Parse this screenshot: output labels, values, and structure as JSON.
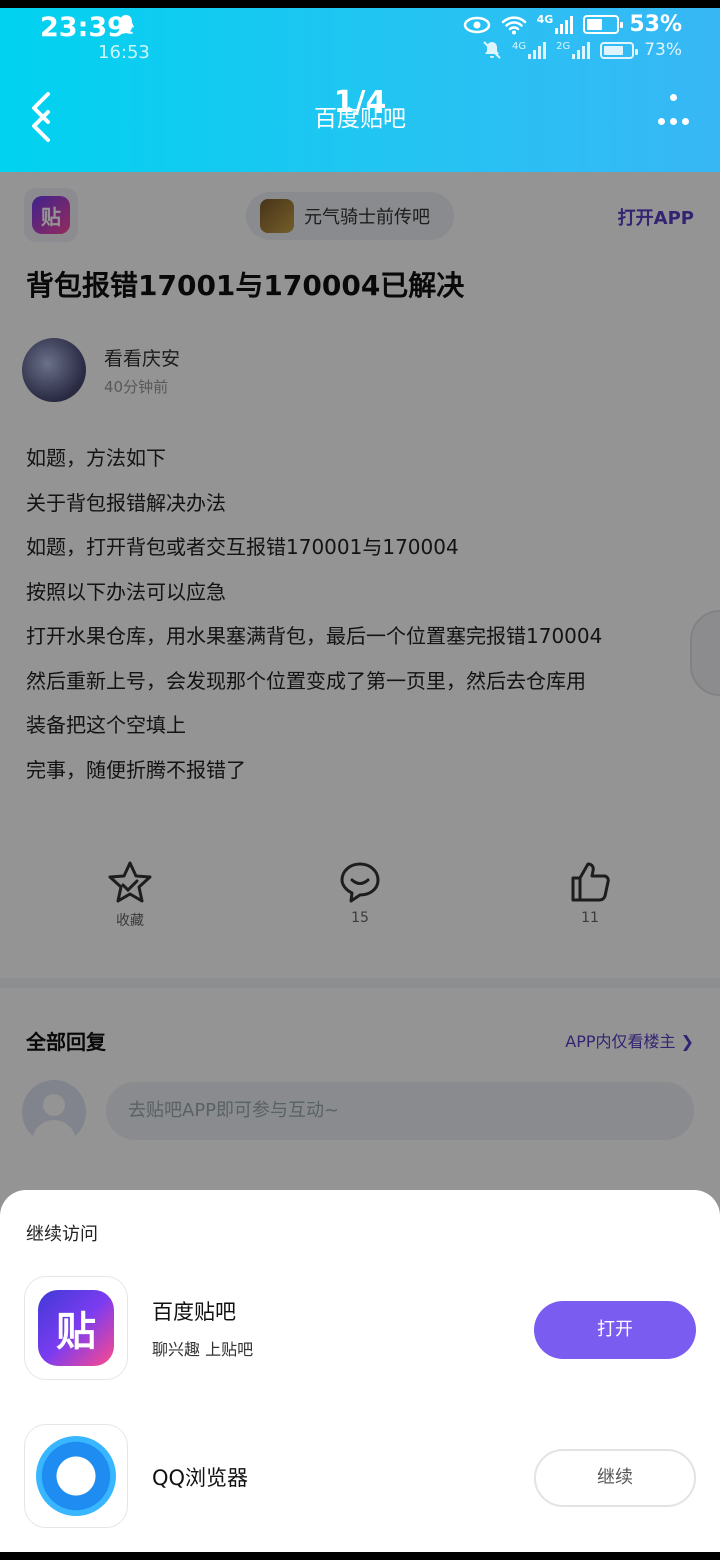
{
  "status_bar": {
    "time": "23:39",
    "time_secondary": "16:53",
    "network_primary": "4G",
    "battery_primary": "53%",
    "network_secondary_1": "4G",
    "network_secondary_2": "2G",
    "battery_secondary": "73%",
    "battery_primary_fraction": 0.53,
    "battery_secondary_fraction": 0.73
  },
  "header": {
    "page_counter": "1/4",
    "title": "百度贴吧",
    "back_icon": "chevron-left-icon",
    "more_icon": "more-dots-icon"
  },
  "forum": {
    "logo_text": "贴",
    "name": "元气骑士前传吧",
    "open_app": "打开APP"
  },
  "post": {
    "title": "背包报错17001与170004已解决",
    "author": "看看庆安",
    "time": "40分钟前",
    "lines": [
      "如题，方法如下",
      "关于背包报错解决办法",
      "如题，打开背包或者交互报错170001与170004",
      "按照以下办法可以应急",
      "打开水果仓库，用水果塞满背包，最后一个位置塞完报错170004",
      "然后重新上号，会发现那个位置变成了第一页里，然后去仓库用",
      "装备把这个空填上",
      "完事，随便折腾不报错了"
    ]
  },
  "actions": {
    "favorite": "收藏",
    "comments": "15",
    "likes": "11"
  },
  "replies": {
    "title": "全部回复",
    "owner_only": "APP内仅看楼主 ❯",
    "input_placeholder": "去贴吧APP即可参与互动~"
  },
  "sheet": {
    "title": "继续访问",
    "apps": [
      {
        "name": "百度贴吧",
        "desc": "聊兴趣 上贴吧",
        "action": "打开",
        "icon_text": "贴"
      },
      {
        "name": "QQ浏览器",
        "desc": "",
        "action": "继续"
      }
    ]
  },
  "colors": {
    "header_gradient_start": "#00d2f0",
    "header_gradient_end": "#38b7f5",
    "accent_purple": "#7b5cf0",
    "link_purple": "#5b3cc4"
  }
}
